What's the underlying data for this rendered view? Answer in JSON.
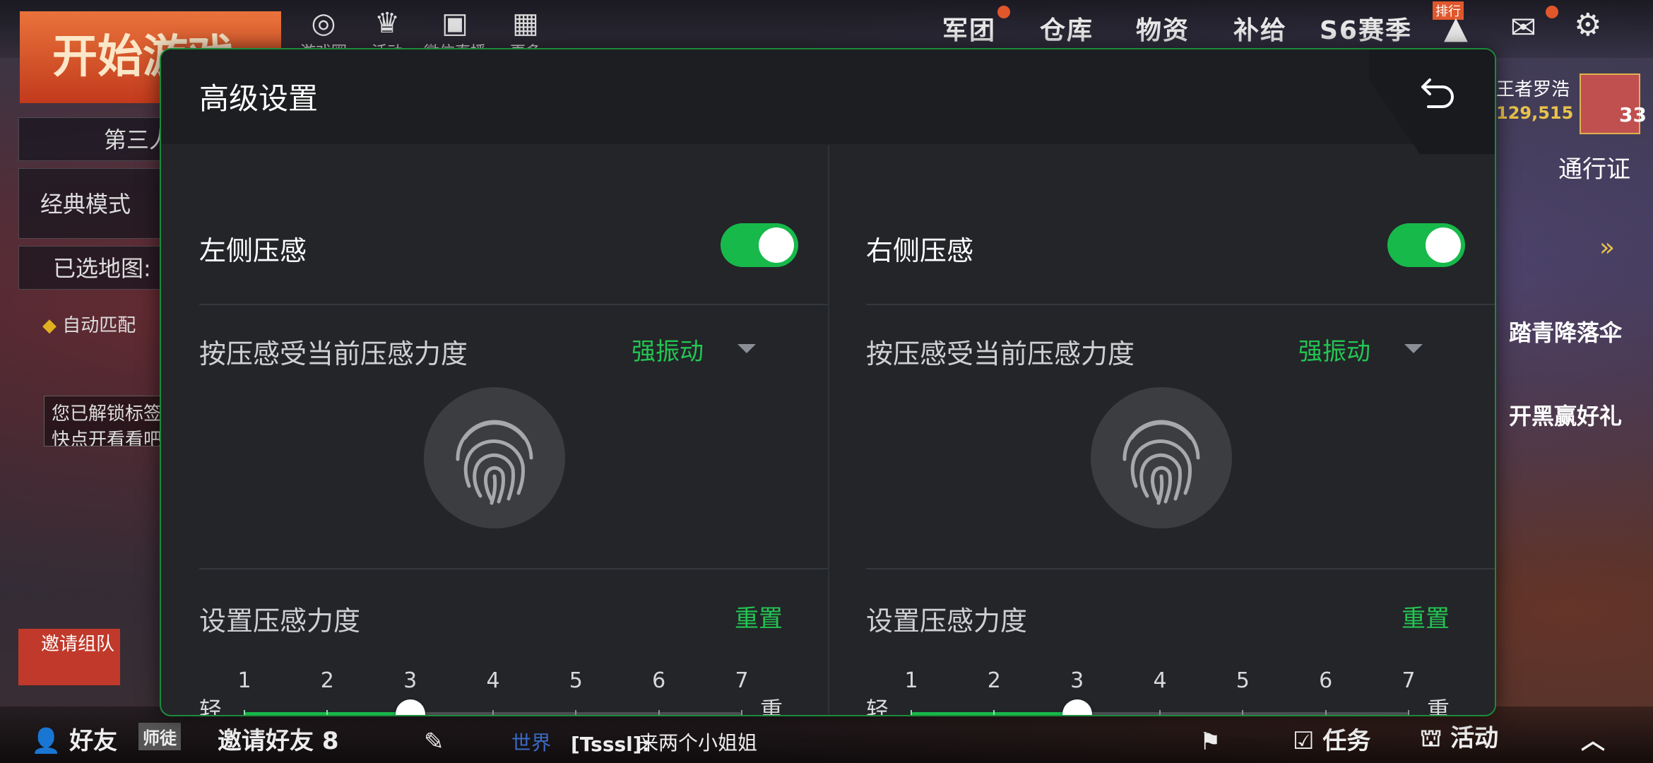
{
  "background": {
    "start_button": "开始游戏",
    "top_left_icons": [
      {
        "label": "游戏圈",
        "icon": "circle-icon"
      },
      {
        "label": "活动",
        "icon": "crown-icon"
      },
      {
        "label": "微信直播",
        "icon": "live-icon"
      },
      {
        "label": "更多",
        "icon": "grid-icon"
      }
    ],
    "top_menu": [
      "军团",
      "仓库",
      "物资",
      "补给",
      "S6赛季"
    ],
    "rank_badge": "排行",
    "left_panel": {
      "perspective": "第三人",
      "mode": "经典模式",
      "map": "已选地图:",
      "auto_match": "自动匹配",
      "unlock_text_1": "您已解锁标签",
      "unlock_text_2": "快点开看看吧"
    },
    "player": {
      "name": "王者罗浩",
      "coins": "129,515",
      "level": "33"
    },
    "pass_label": "通行证",
    "events": [
      "踏青降落伞",
      "开黑赢好礼"
    ],
    "bottom": {
      "friends": "好友",
      "mentor": "师徒",
      "invite": "邀请好友 8",
      "invite_team": "邀请组队",
      "chat_channel": "世界",
      "chat_user": "[Tsssl]:",
      "chat_message": "来两个小姐姐",
      "tasks": "任务",
      "activities": "活动"
    }
  },
  "modal": {
    "title": "高级设置",
    "back_icon": "back-arrow-icon",
    "accent_color": "#17b94a",
    "left": {
      "toggle_label": "左侧压感",
      "toggle_on": true,
      "feedback_label": "按压感受当前压感力度",
      "feedback_value": "强振动",
      "strength_label": "设置压感力度",
      "reset_label": "重置",
      "slider": {
        "min_label": "轻",
        "max_label": "重",
        "ticks": [
          "1",
          "2",
          "3",
          "4",
          "5",
          "6",
          "7"
        ],
        "value": 3
      }
    },
    "right": {
      "toggle_label": "右侧压感",
      "toggle_on": true,
      "feedback_label": "按压感受当前压感力度",
      "feedback_value": "强振动",
      "strength_label": "设置压感力度",
      "reset_label": "重置",
      "slider": {
        "min_label": "轻",
        "max_label": "重",
        "ticks": [
          "1",
          "2",
          "3",
          "4",
          "5",
          "6",
          "7"
        ],
        "value": 3
      }
    }
  }
}
